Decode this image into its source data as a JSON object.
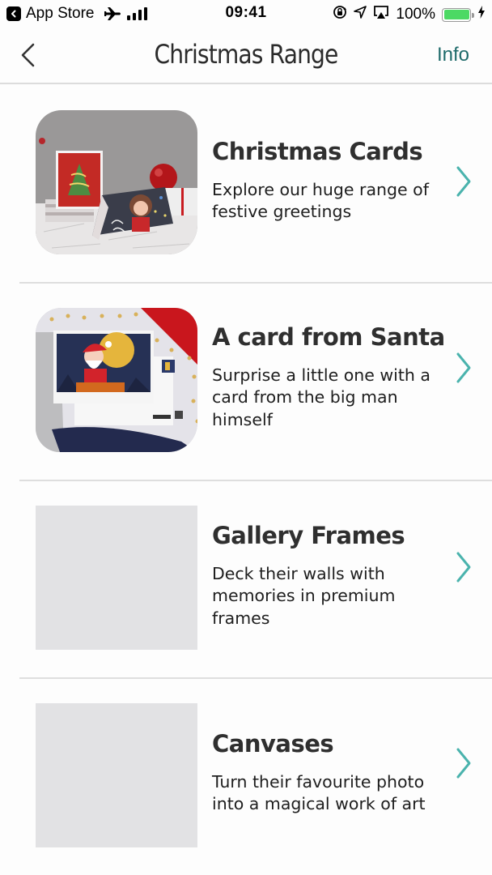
{
  "status_bar": {
    "back_app": "App Store",
    "time": "09:41",
    "battery_percent": "100%",
    "battery_level": 1.0,
    "icons": [
      "back-arrow-icon",
      "airplane-icon",
      "signal-icon",
      "rotation-lock-icon",
      "location-icon",
      "airplay-icon",
      "battery-icon",
      "charging-bolt-icon"
    ]
  },
  "nav": {
    "title": "Christmas Range",
    "info_label": "Info",
    "back_icon": "chevron-left-icon"
  },
  "colors": {
    "accent": "#1f6b6b",
    "chevron": "#4ab3ad",
    "placeholder": "#e2e2e4",
    "divider": "#dedede",
    "battery_fill": "#4cd964"
  },
  "items": [
    {
      "title": "Christmas Cards",
      "description": "Explore our huge range of festive greetings",
      "image": "christmas-cards-photo"
    },
    {
      "title": "A card from Santa",
      "description": "Surprise a little one with a card from the big man himself",
      "image": "santa-card-photo"
    },
    {
      "title": "Gallery Frames",
      "description": "Deck their walls with memories in premium frames",
      "image": "placeholder"
    },
    {
      "title": "Canvases",
      "description": "Turn their favourite photo into a magical work of art",
      "image": "placeholder"
    }
  ]
}
